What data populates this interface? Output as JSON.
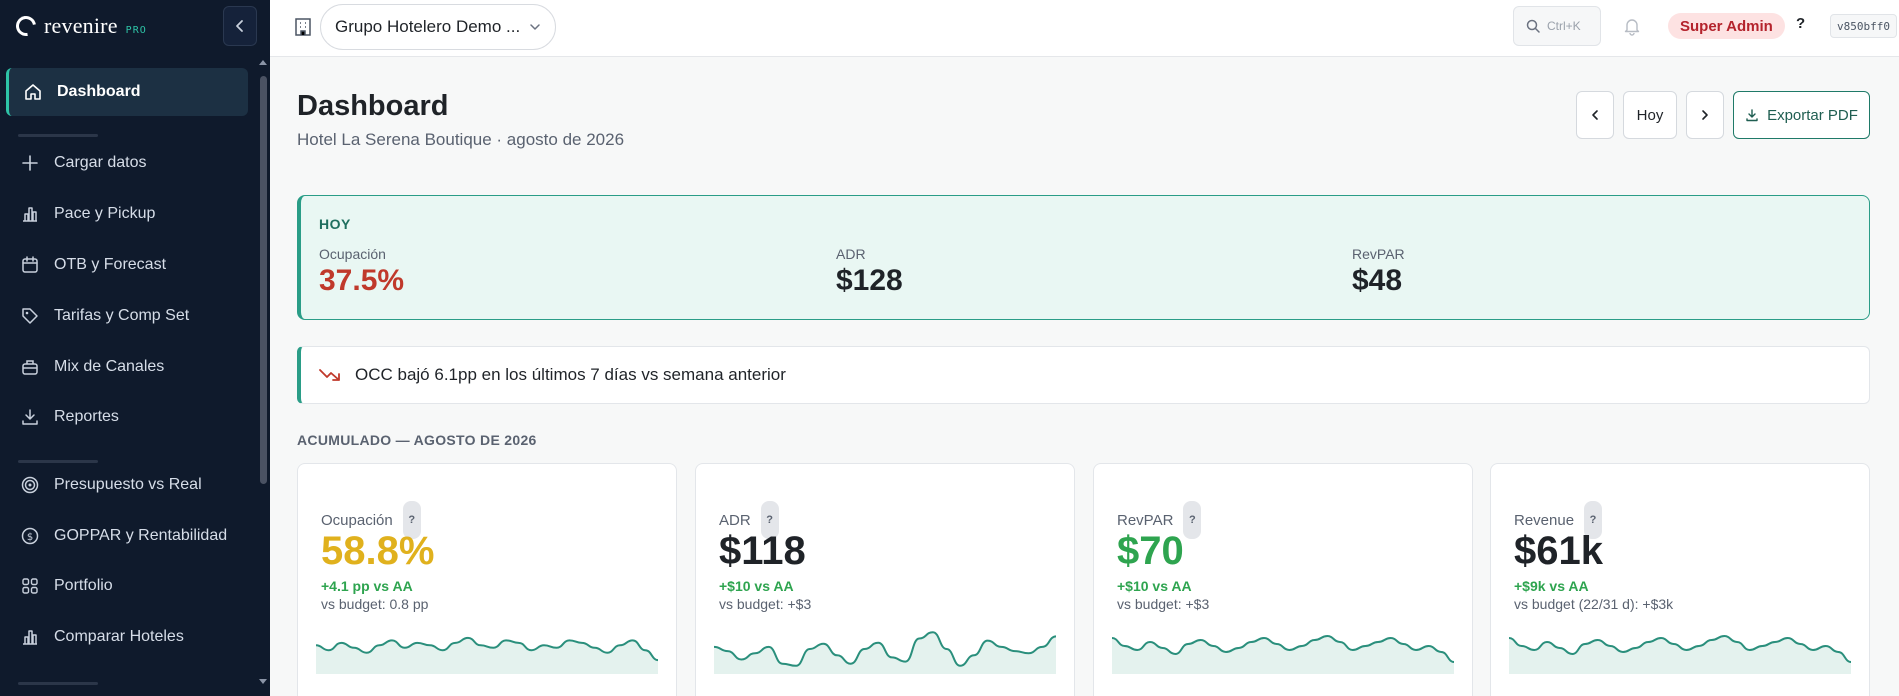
{
  "sidebar": {
    "brand": {
      "name": "revenire",
      "tag": "PRO"
    },
    "collapse_icon": "chevron-left-icon",
    "items": [
      {
        "label": "Dashboard",
        "icon": "home-icon",
        "active": true
      },
      {
        "label": "Cargar datos",
        "icon": "plus-icon"
      },
      {
        "label": "Pace y Pickup",
        "icon": "bar-chart-icon"
      },
      {
        "label": "OTB y Forecast",
        "icon": "calendar-icon"
      },
      {
        "label": "Tarifas y Comp Set",
        "icon": "tag-icon"
      },
      {
        "label": "Mix de Canales",
        "icon": "briefcase-icon"
      },
      {
        "label": "Reportes",
        "icon": "download-icon"
      },
      {
        "label": "Presupuesto vs Real",
        "icon": "target-icon"
      },
      {
        "label": "GOPPAR y Rentabilidad",
        "icon": "dollar-circle-icon"
      },
      {
        "label": "Portfolio",
        "icon": "grid-icon"
      },
      {
        "label": "Comparar Hoteles",
        "icon": "bar-chart-icon"
      }
    ]
  },
  "topbar": {
    "hotel_group": "Grupo Hotelero Demo ...",
    "search_shortcut": "Ctrl+K",
    "role_badge": "Super Admin",
    "help_label": "?",
    "version": "v850bff0"
  },
  "header": {
    "title": "Dashboard",
    "subtitle": "Hotel La Serena Boutique · agosto de 2026",
    "today_button": "Hoy",
    "export_button": "Exportar PDF"
  },
  "today": {
    "label": "HOY",
    "metrics": [
      {
        "label": "Ocupación",
        "value": "37.5%",
        "color": "#c0392b"
      },
      {
        "label": "ADR",
        "value": "$128"
      },
      {
        "label": "RevPAR",
        "value": "$48"
      }
    ]
  },
  "alert": {
    "icon": "trend-down-icon",
    "text": "OCC bajó 6.1pp en los últimos 7 días vs semana anterior"
  },
  "accumulated": {
    "title": "ACUMULADO — AGOSTO DE 2026",
    "cards": [
      {
        "label": "Ocupación",
        "help": "?",
        "value": "58.8%",
        "value_color": "#e0b11d",
        "delta": "+4.1 pp vs AA",
        "budget": "vs budget: 0.8 pp",
        "spark": [
          50,
          48,
          51,
          49,
          47,
          50,
          52,
          49,
          51,
          50,
          48,
          51,
          53,
          50,
          49,
          52,
          51,
          48,
          50,
          49,
          52,
          51,
          49,
          47,
          50,
          52,
          48,
          44
        ]
      },
      {
        "label": "ADR",
        "help": "?",
        "value": "$118",
        "value_color": "#1f2328",
        "delta": "+$10 vs AA",
        "budget": "vs budget: +$3",
        "spark": [
          52,
          48,
          40,
          46,
          52,
          36,
          34,
          50,
          55,
          44,
          36,
          50,
          56,
          42,
          38,
          60,
          66,
          50,
          34,
          44,
          58,
          52,
          48,
          46,
          52,
          62
        ]
      },
      {
        "label": "RevPAR",
        "help": "?",
        "value": "$70",
        "value_color": "#2ea44f",
        "delta": "+$10 vs AA",
        "budget": "vs budget: +$3",
        "spark": [
          56,
          52,
          50,
          54,
          51,
          48,
          53,
          55,
          52,
          49,
          51,
          54,
          56,
          53,
          50,
          52,
          55,
          57,
          54,
          50,
          52,
          54,
          56,
          53,
          50,
          52,
          49,
          44
        ]
      },
      {
        "label": "Revenue",
        "help": "?",
        "value": "$61k",
        "value_color": "#1f2328",
        "delta": "+$9k vs AA",
        "budget": "vs budget (22/31 d): +$3k",
        "spark": [
          56,
          52,
          50,
          54,
          51,
          48,
          53,
          55,
          52,
          49,
          51,
          54,
          56,
          53,
          50,
          52,
          55,
          57,
          54,
          50,
          52,
          54,
          56,
          53,
          50,
          52,
          49,
          44
        ]
      }
    ]
  }
}
